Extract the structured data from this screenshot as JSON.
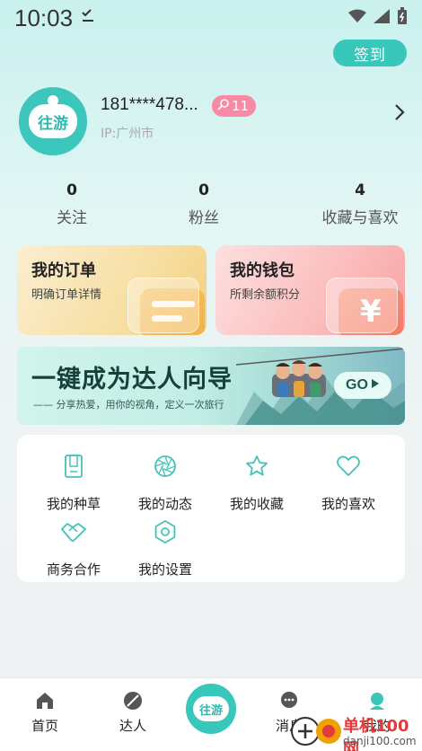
{
  "status_bar": {
    "time": "10:03"
  },
  "checkin_label": "签到",
  "profile": {
    "avatar_text": "往游",
    "phone": "181****478...",
    "level": "11",
    "ip": "IP:广州市"
  },
  "stats": [
    {
      "num": "0",
      "label": "关注"
    },
    {
      "num": "0",
      "label": "粉丝"
    },
    {
      "num": "4",
      "label": "收藏与喜欢"
    }
  ],
  "cards": {
    "orders": {
      "title": "我的订单",
      "sub": "明确订单详情"
    },
    "wallet": {
      "title": "我的钱包",
      "sub": "所剩余额积分",
      "icon_glyph": "¥"
    }
  },
  "banner": {
    "title": "一键成为达人向导",
    "sub": "—— 分享热爱，用你的视角，定义一次旅行",
    "go": "GO"
  },
  "menu": [
    {
      "label": "我的种草",
      "icon": "notebook-icon"
    },
    {
      "label": "我的动态",
      "icon": "aperture-icon"
    },
    {
      "label": "我的收藏",
      "icon": "star-icon"
    },
    {
      "label": "我的喜欢",
      "icon": "heart-icon"
    },
    {
      "label": "商务合作",
      "icon": "handshake-icon"
    },
    {
      "label": "我的设置",
      "icon": "settings-icon"
    }
  ],
  "nav": [
    {
      "label": "首页",
      "icon": "home-icon"
    },
    {
      "label": "达人",
      "icon": "leaf-icon"
    },
    {
      "label": "往游",
      "icon": "app-logo-icon"
    },
    {
      "label": "消息",
      "icon": "message-icon"
    },
    {
      "label": "我的",
      "icon": "profile-icon"
    }
  ],
  "watermark": {
    "name": "单机100网",
    "url": "danji100.com"
  },
  "colors": {
    "accent": "#39c6bb",
    "badge": "#f98aa5"
  }
}
